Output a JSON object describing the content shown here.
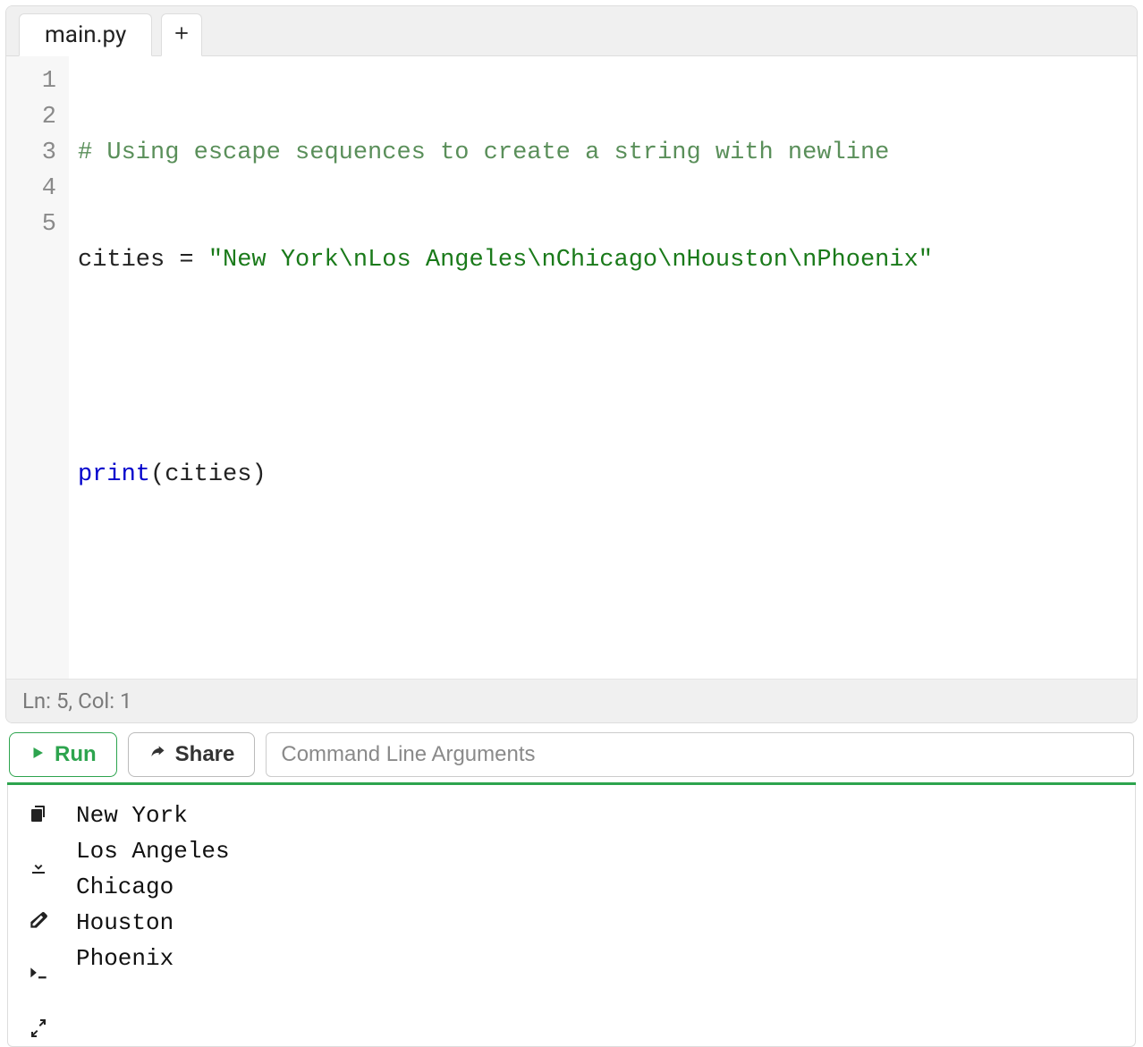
{
  "tabs": {
    "active": "main.py"
  },
  "editor": {
    "lines": [
      {
        "n": "1"
      },
      {
        "n": "2"
      },
      {
        "n": "3"
      },
      {
        "n": "4"
      },
      {
        "n": "5"
      }
    ],
    "code": {
      "line1_comment": "# Using escape sequences to create a string with newline",
      "line2_var": "cities",
      "line2_eq": " = ",
      "line2_q1": "\"",
      "line2_s1": "New York",
      "line2_e1": "\\n",
      "line2_s2": "Los Angeles",
      "line2_e2": "\\n",
      "line2_s3": "Chicago",
      "line2_e3": "\\n",
      "line2_s4": "Houston",
      "line2_e4": "\\n",
      "line2_s5": "Phoenix",
      "line2_q2": "\"",
      "line4_func": "print",
      "line4_lp": "(",
      "line4_arg": "cities",
      "line4_rp": ")"
    }
  },
  "status": {
    "text": "Ln: 5,  Col: 1"
  },
  "toolbar": {
    "run_label": "Run",
    "share_label": "Share",
    "cmd_placeholder": "Command Line Arguments"
  },
  "output": {
    "lines": [
      "New York",
      "Los Angeles",
      "Chicago",
      "Houston",
      "Phoenix"
    ]
  }
}
